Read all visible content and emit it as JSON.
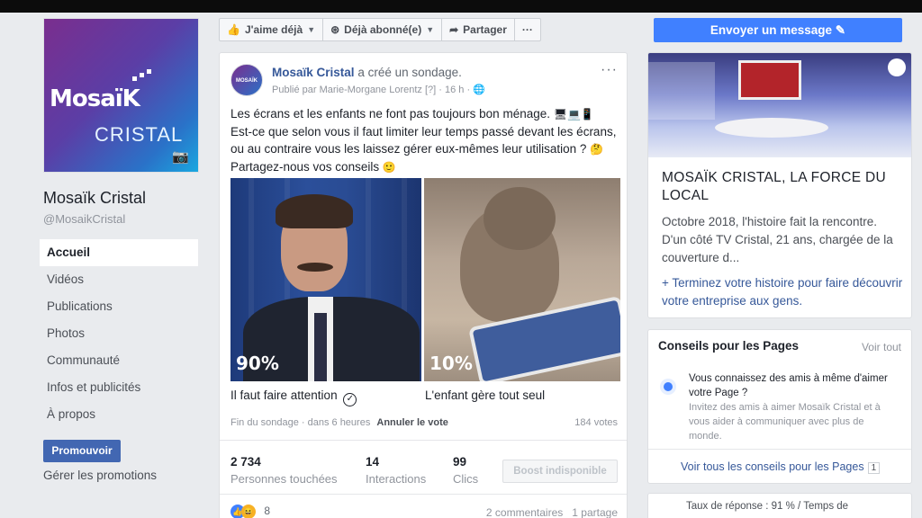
{
  "page": {
    "name": "Mosaïk Cristal",
    "handle": "@MosaikCristal",
    "logo_main": "MosaïK",
    "logo_sub": "CRISTAL"
  },
  "nav": {
    "items": [
      {
        "label": "Accueil",
        "active": true
      },
      {
        "label": "Vidéos"
      },
      {
        "label": "Publications"
      },
      {
        "label": "Photos"
      },
      {
        "label": "Communauté"
      },
      {
        "label": "Infos et publicités"
      },
      {
        "label": "À propos"
      }
    ],
    "promote_label": "Promouvoir",
    "manage_promotions": "Gérer les promotions"
  },
  "toolbar": {
    "like_label": "J'aime déjà",
    "follow_label": "Déjà abonné(e)",
    "share_label": "Partager",
    "more_label": "···",
    "message_label": "Envoyer un message"
  },
  "post": {
    "author": "Mosaïk Cristal",
    "action": "a créé un sondage.",
    "published_by": "Publié par Marie-Morgane Lorentz",
    "help": "[?]",
    "time": "16 h",
    "text_line1": "Les écrans et les enfants ne font pas toujours bon ménage.",
    "text_line2": "Est-ce que selon vous il faut limiter leur temps passé devant les écrans,",
    "text_line3": "ou au contraire vous les laissez gérer eux-mêmes leur utilisation ?",
    "text_line4": "Partagez-nous vos conseils",
    "poll": {
      "options": [
        {
          "label": "Il faut faire attention",
          "percent": "90%",
          "selected": true
        },
        {
          "label": "L'enfant gère tout seul",
          "percent": "10%",
          "selected": false
        }
      ],
      "end_text": "Fin du sondage · dans 6 heures",
      "undo_label": "Annuler le vote",
      "votes": "184 votes"
    },
    "stats": [
      {
        "value": "2 734",
        "label": "Personnes touchées"
      },
      {
        "value": "14",
        "label": "Interactions"
      },
      {
        "value": "99",
        "label": "Clics"
      }
    ],
    "boost_label": "Boost indisponible",
    "reactions_count": "8",
    "comments": "2 commentaires",
    "shares": "1 partage"
  },
  "story": {
    "title": "MOSAÏK CRISTAL, LA FORCE DU LOCAL",
    "body": "Octobre 2018, l'histoire fait la rencontre. D'un côté TV Cristal, 21 ans, chargée de la couverture d...",
    "link": "+ Terminez votre histoire pour faire découvrir votre entreprise aux gens."
  },
  "tips": {
    "title": "Conseils pour les Pages",
    "see_all": "Voir tout",
    "head": "Vous connaissez des amis à même d'aimer votre Page ?",
    "desc": "Invitez des amis à aimer Mosaïk Cristal et à vous aider à communiquer avec plus de monde.",
    "all_tips": "Voir tous les conseils pour les Pages",
    "count": "1"
  },
  "response": {
    "text": "Taux de réponse : 91 % / Temps de"
  },
  "colors": {
    "accent": "#4267b2",
    "message_button": "#4080ff",
    "link": "#365899"
  }
}
